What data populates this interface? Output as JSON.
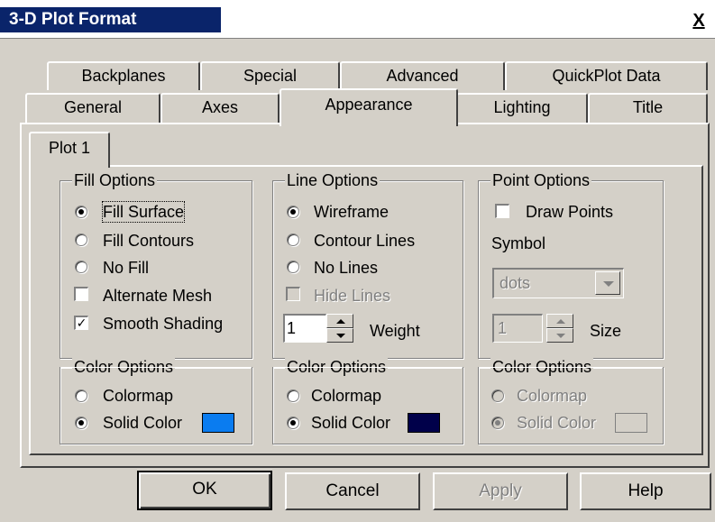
{
  "window": {
    "title": "3-D Plot Format",
    "close_glyph": "X"
  },
  "tabs_back": [
    "Backplanes",
    "Special",
    "Advanced",
    "QuickPlot Data"
  ],
  "tabs_front": [
    "General",
    "Axes",
    "Appearance",
    "Lighting",
    "Title"
  ],
  "active_tab": "Appearance",
  "subtab": "Plot 1",
  "fill_options": {
    "title": "Fill Options",
    "fill_surface": "Fill Surface",
    "fill_contours": "Fill Contours",
    "no_fill": "No Fill",
    "alternate_mesh": "Alternate Mesh",
    "smooth_shading": "Smooth Shading",
    "selected": "Fill Surface",
    "alternate_mesh_checked": false,
    "smooth_shading_checked": true
  },
  "line_options": {
    "title": "Line Options",
    "wireframe": "Wireframe",
    "contour_lines": "Contour Lines",
    "no_lines": "No Lines",
    "hide_lines": "Hide Lines",
    "weight_value": "1",
    "weight_label": "Weight",
    "selected": "Wireframe"
  },
  "point_options": {
    "title": "Point Options",
    "draw_points": "Draw Points",
    "symbol_label": "Symbol",
    "symbol_value": "dots",
    "size_value": "1",
    "size_label": "Size"
  },
  "color_options": {
    "title": "Color Options",
    "colormap": "Colormap",
    "solid_color": "Solid Color",
    "fill_color": "#0a7cf0",
    "line_color": "#00004a"
  },
  "buttons": {
    "ok": "OK",
    "cancel": "Cancel",
    "apply": "Apply",
    "help": "Help"
  }
}
